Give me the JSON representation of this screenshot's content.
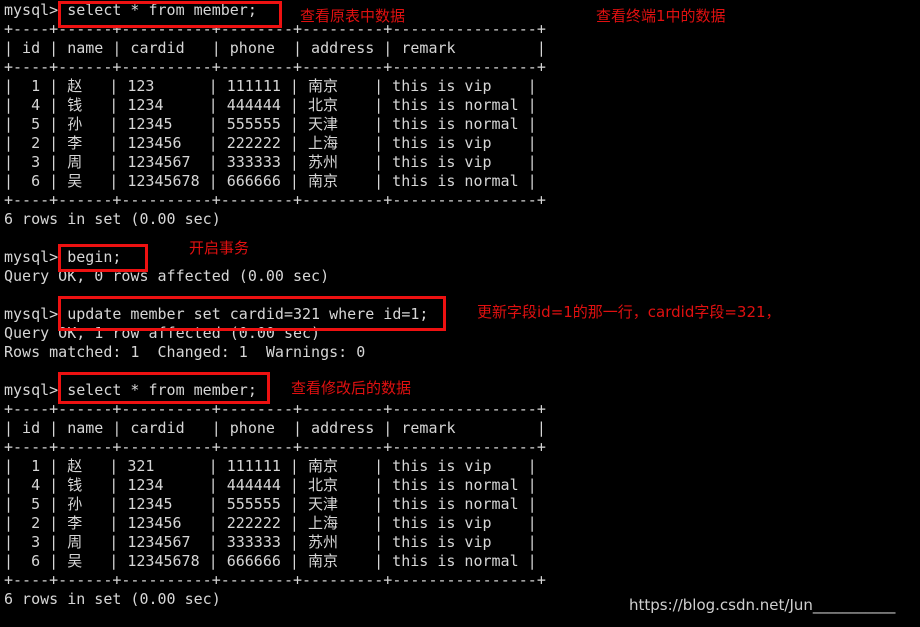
{
  "terminal": {
    "prompt": "mysql>",
    "background_color": "#000000",
    "text_color": "#d6d6d6",
    "annotation_color": "#e01010",
    "box_color": "#ee1111",
    "lines": [
      "mysql> select * from member;",
      "+----+------+----------+--------+---------+----------------+",
      "| id | name | cardid   | phone  | address | remark         |",
      "+----+------+----------+--------+---------+----------------+",
      "|  1 | 赵   | 123      | 111111 | 南京    | this is vip    |",
      "|  4 | 钱   | 1234     | 444444 | 北京    | this is normal |",
      "|  5 | 孙   | 12345    | 555555 | 天津    | this is normal |",
      "|  2 | 李   | 123456   | 222222 | 上海    | this is vip    |",
      "|  3 | 周   | 1234567  | 333333 | 苏州    | this is vip    |",
      "|  6 | 吴   | 12345678 | 666666 | 南京    | this is normal |",
      "+----+------+----------+--------+---------+----------------+",
      "6 rows in set (0.00 sec)",
      "",
      "mysql> begin;",
      "Query OK, 0 rows affected (0.00 sec)",
      "",
      "mysql> update member set cardid=321 where id=1;",
      "Query OK, 1 row affected (0.00 sec)",
      "Rows matched: 1  Changed: 1  Warnings: 0",
      "",
      "mysql> select * from member;",
      "+----+------+----------+--------+---------+----------------+",
      "| id | name | cardid   | phone  | address | remark         |",
      "+----+------+----------+--------+---------+----------------+",
      "|  1 | 赵   | 321      | 111111 | 南京    | this is vip    |",
      "|  4 | 钱   | 1234     | 444444 | 北京    | this is normal |",
      "|  5 | 孙   | 12345    | 555555 | 天津    | this is normal |",
      "|  2 | 李   | 123456   | 222222 | 上海    | this is vip    |",
      "|  3 | 周   | 1234567  | 333333 | 苏州    | this is vip    |",
      "|  6 | 吴   | 12345678 | 666666 | 南京    | this is normal |",
      "+----+------+----------+--------+---------+----------------+",
      "6 rows in set (0.00 sec)"
    ]
  },
  "commands": {
    "select_first": "select * from member;",
    "begin": "begin;",
    "update": "update member set cardid=321 where id=1;",
    "select_second": "select * from member;"
  },
  "tables": {
    "headers": [
      "id",
      "name",
      "cardid",
      "phone",
      "address",
      "remark"
    ],
    "before": [
      {
        "id": "1",
        "name": "赵",
        "cardid": "123",
        "phone": "111111",
        "address": "南京",
        "remark": "this is vip"
      },
      {
        "id": "4",
        "name": "钱",
        "cardid": "1234",
        "phone": "444444",
        "address": "北京",
        "remark": "this is normal"
      },
      {
        "id": "5",
        "name": "孙",
        "cardid": "12345",
        "phone": "555555",
        "address": "天津",
        "remark": "this is normal"
      },
      {
        "id": "2",
        "name": "李",
        "cardid": "123456",
        "phone": "222222",
        "address": "上海",
        "remark": "this is vip"
      },
      {
        "id": "3",
        "name": "周",
        "cardid": "1234567",
        "phone": "333333",
        "address": "苏州",
        "remark": "this is vip"
      },
      {
        "id": "6",
        "name": "吴",
        "cardid": "12345678",
        "phone": "666666",
        "address": "南京",
        "remark": "this is normal"
      }
    ],
    "after": [
      {
        "id": "1",
        "name": "赵",
        "cardid": "321",
        "phone": "111111",
        "address": "南京",
        "remark": "this is vip"
      },
      {
        "id": "4",
        "name": "钱",
        "cardid": "1234",
        "phone": "444444",
        "address": "北京",
        "remark": "this is normal"
      },
      {
        "id": "5",
        "name": "孙",
        "cardid": "12345",
        "phone": "555555",
        "address": "天津",
        "remark": "this is normal"
      },
      {
        "id": "2",
        "name": "李",
        "cardid": "123456",
        "phone": "222222",
        "address": "上海",
        "remark": "this is vip"
      },
      {
        "id": "3",
        "name": "周",
        "cardid": "1234567",
        "phone": "333333",
        "address": "苏州",
        "remark": "this is vip"
      },
      {
        "id": "6",
        "name": "吴",
        "cardid": "12345678",
        "phone": "666666",
        "address": "南京",
        "remark": "this is normal"
      }
    ],
    "row_count_text": "6 rows in set (0.00 sec)"
  },
  "results": {
    "begin_result": "Query OK, 0 rows affected (0.00 sec)",
    "update_result": "Query OK, 1 row affected (0.00 sec)",
    "update_matched": "Rows matched: 1  Changed: 1  Warnings: 0"
  },
  "annotations": {
    "view_original": "查看原表中数据",
    "view_terminal1": "查看终端1中的数据",
    "begin_transaction": "开启事务",
    "update_desc": "更新字段id=1的那一行，cardid字段=321，",
    "view_modified": "查看修改后的数据"
  },
  "watermark": {
    "text": "https://blog.csdn.net/Jun___________"
  }
}
